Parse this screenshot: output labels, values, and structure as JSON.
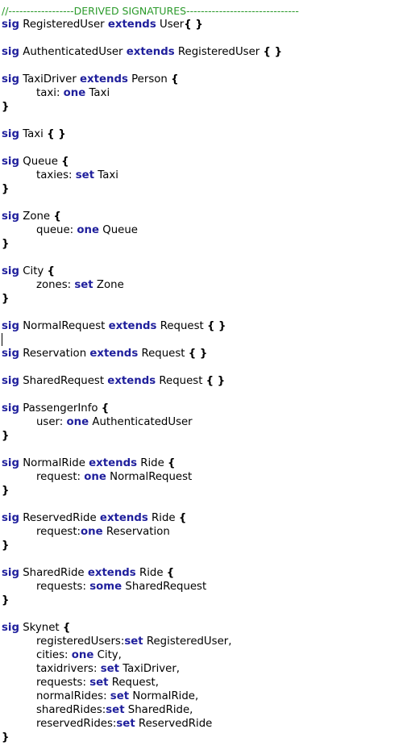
{
  "comment": "//------------------DERIVED SIGNATURES-------------------------------",
  "kw": {
    "sig": "sig",
    "extends": "extends",
    "one": "one",
    "set": "set",
    "some": "some"
  },
  "punct": {
    "open": "{",
    "close": "}",
    "empty": "{ }",
    "colon": ":",
    "comma": ","
  },
  "colors": {
    "keyword": "#1f1f9c",
    "comment": "#2b9a2b",
    "text": "#000000"
  },
  "decls": [
    {
      "name": "RegisteredUser",
      "parent": "User"
    },
    {
      "name": "AuthenticatedUser",
      "parent": "RegisteredUser"
    },
    {
      "name": "TaxiDriver",
      "parent": "Person",
      "fields": [
        {
          "name": "taxi",
          "mult": "one",
          "type": "Taxi"
        }
      ]
    },
    {
      "name": "Taxi"
    },
    {
      "name": "Queue",
      "fields": [
        {
          "name": "taxies",
          "mult": "set",
          "type": "Taxi"
        }
      ]
    },
    {
      "name": "Zone",
      "fields": [
        {
          "name": "queue",
          "mult": "one",
          "type": "Queue"
        }
      ]
    },
    {
      "name": "City",
      "fields": [
        {
          "name": "zones",
          "mult": "set",
          "type": "Zone"
        }
      ]
    },
    {
      "name": "NormalRequest",
      "parent": "Request"
    },
    {
      "name": "Reservation",
      "parent": "Request"
    },
    {
      "name": "SharedRequest",
      "parent": "Request"
    },
    {
      "name": "PassengerInfo",
      "fields": [
        {
          "name": "user",
          "mult": "one",
          "type": "AuthenticatedUser"
        }
      ]
    },
    {
      "name": "NormalRide",
      "parent": "Ride",
      "fields": [
        {
          "name": "request",
          "mult": "one",
          "type": "NormalRequest"
        }
      ]
    },
    {
      "name": "ReservedRide",
      "parent": "Ride",
      "fields": [
        {
          "name": "request",
          "mult": "one",
          "type": "Reservation"
        }
      ]
    },
    {
      "name": "SharedRide",
      "parent": "Ride",
      "fields": [
        {
          "name": "requests",
          "mult": "some",
          "type": "SharedRequest"
        }
      ]
    },
    {
      "name": "Skynet",
      "fields": [
        {
          "name": "registeredUsers",
          "mult": "set",
          "type": "RegisteredUser"
        },
        {
          "name": "cities",
          "mult": "one",
          "type": "City"
        },
        {
          "name": "taxidrivers",
          "mult": "set",
          "type": "TaxiDriver"
        },
        {
          "name": "requests",
          "mult": "set",
          "type": "Request"
        },
        {
          "name": "normalRides",
          "mult": "set",
          "type": "NormalRide"
        },
        {
          "name": "sharedRides",
          "mult": "set",
          "type": "SharedRide"
        },
        {
          "name": "reservedRides",
          "mult": "set",
          "type": "ReservedRide"
        }
      ]
    }
  ]
}
